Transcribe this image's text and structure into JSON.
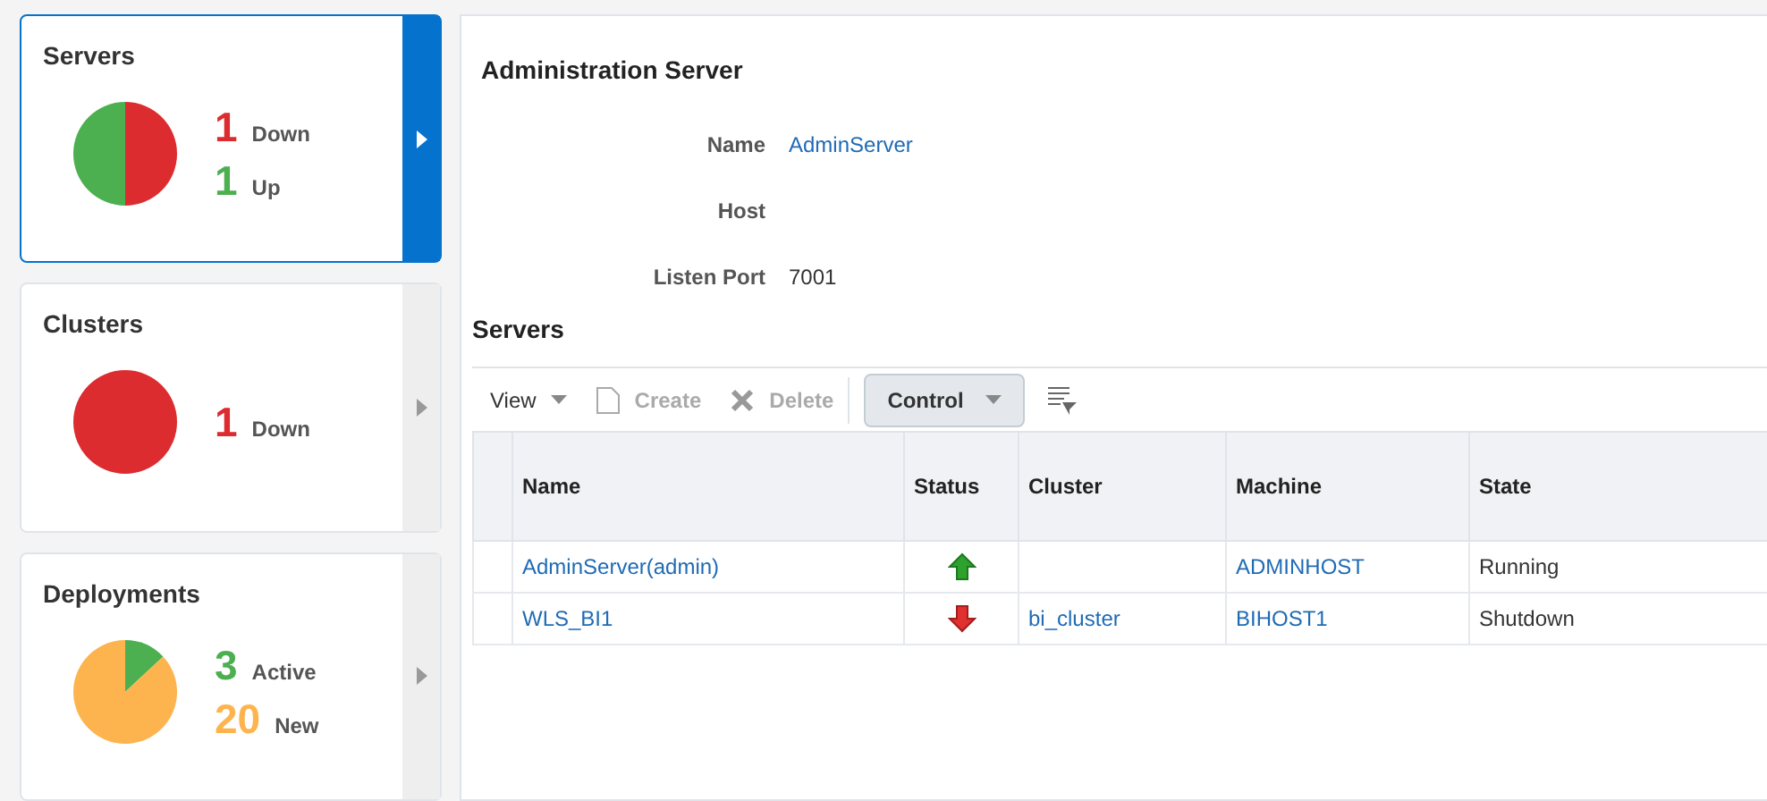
{
  "cards": [
    {
      "title": "Servers",
      "selected": true,
      "stats": [
        {
          "count": "1",
          "label": "Down",
          "color": "#dd2c2f"
        },
        {
          "count": "1",
          "label": "Up",
          "color": "#4caf50"
        }
      ]
    },
    {
      "title": "Clusters",
      "selected": false,
      "stats": [
        {
          "count": "1",
          "label": "Down",
          "color": "#dd2c2f"
        }
      ]
    },
    {
      "title": "Deployments",
      "selected": false,
      "stats": [
        {
          "count": "3",
          "label": "Active",
          "color": "#4caf50"
        },
        {
          "count": "20",
          "label": "New",
          "color": "#fdb44e"
        }
      ]
    }
  ],
  "admin_server": {
    "title": "Administration Server",
    "fields": [
      {
        "label": "Name",
        "value": "AdminServer",
        "kind": "link"
      },
      {
        "label": "Host"
      },
      {
        "label": "Listen Port",
        "value": "7001",
        "kind": "text"
      }
    ]
  },
  "servers": {
    "title": "Servers",
    "toolbar": [
      {
        "label": "View",
        "kind": "menu",
        "disabled": false
      },
      {
        "label": "Create",
        "kind": "create",
        "disabled": true
      },
      {
        "label": "Delete",
        "kind": "delete",
        "disabled": true
      },
      {
        "label": "Control",
        "kind": "button",
        "disabled": false
      },
      {
        "kind": "filter"
      }
    ],
    "columns": [
      "Name",
      "Status",
      "Cluster",
      "Machine",
      "State"
    ],
    "rows": [
      {
        "name": "AdminServer(admin)",
        "kind": "up",
        "machine": "ADMINHOST",
        "state": "Running"
      },
      {
        "name": "WLS_BI1",
        "kind": "down",
        "cluster": "bi_cluster",
        "machine": "BIHOST1",
        "state": "Shutdown"
      }
    ]
  }
}
